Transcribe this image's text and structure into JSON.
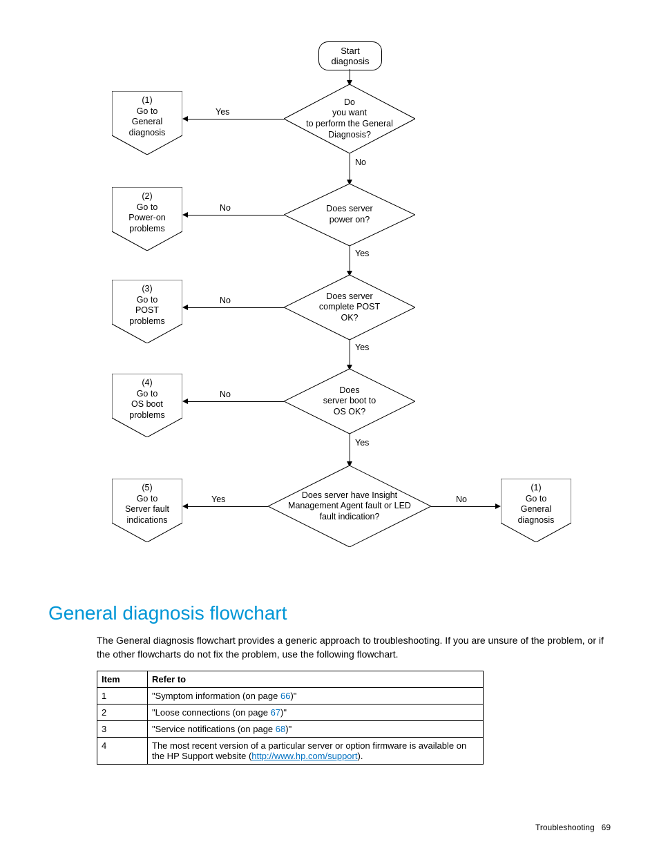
{
  "flow": {
    "start": "Start\ndiagnosis",
    "d1": "Do\nyou want\nto perform the General\nDiagnosis?",
    "d1_yes": "Yes",
    "d1_no": "No",
    "d2": "Does server\npower on?",
    "d2_yes": "Yes",
    "d2_no": "No",
    "d3": "Does server\ncomplete POST\nOK?",
    "d3_yes": "Yes",
    "d3_no": "No",
    "d4": "Does\nserver boot to\nOS OK?",
    "d4_yes": "Yes",
    "d4_no": "No",
    "d5": "Does server\nhave Insight Management\nAgent fault or LED fault\nindication?",
    "d5_yes": "Yes",
    "d5_no": "No",
    "op1": "(1)\nGo to\nGeneral\ndiagnosis",
    "op2": "(2)\nGo to\nPower-on\nproblems",
    "op3": "(3)\nGo to\nPOST\nproblems",
    "op4": "(4)\nGo to\nOS boot\nproblems",
    "op5": "(5)\nGo to\nServer fault\nindications",
    "op6": "(1)\nGo to\nGeneral\ndiagnosis"
  },
  "heading": "General diagnosis flowchart",
  "body": "The General diagnosis flowchart provides a generic approach to troubleshooting. If you are unsure of the problem, or if the other flowcharts do not fix the problem, use the following flowchart.",
  "table": {
    "h1": "Item",
    "h2": "Refer to",
    "rows": [
      {
        "item": "1",
        "pre": "\"Symptom information (on page ",
        "link": "66",
        "post": ")\""
      },
      {
        "item": "2",
        "pre": "\"Loose connections (on page ",
        "link": "67",
        "post": ")\""
      },
      {
        "item": "3",
        "pre": "\"Service notifications (on page ",
        "link": "68",
        "post": ")\""
      },
      {
        "item": "4",
        "pre": "The most recent version of a particular server or option firmware is available on the HP Support website (",
        "link": "http://www.hp.com/support",
        "post": ")."
      }
    ]
  },
  "footer": {
    "section": "Troubleshooting",
    "page": "69"
  }
}
